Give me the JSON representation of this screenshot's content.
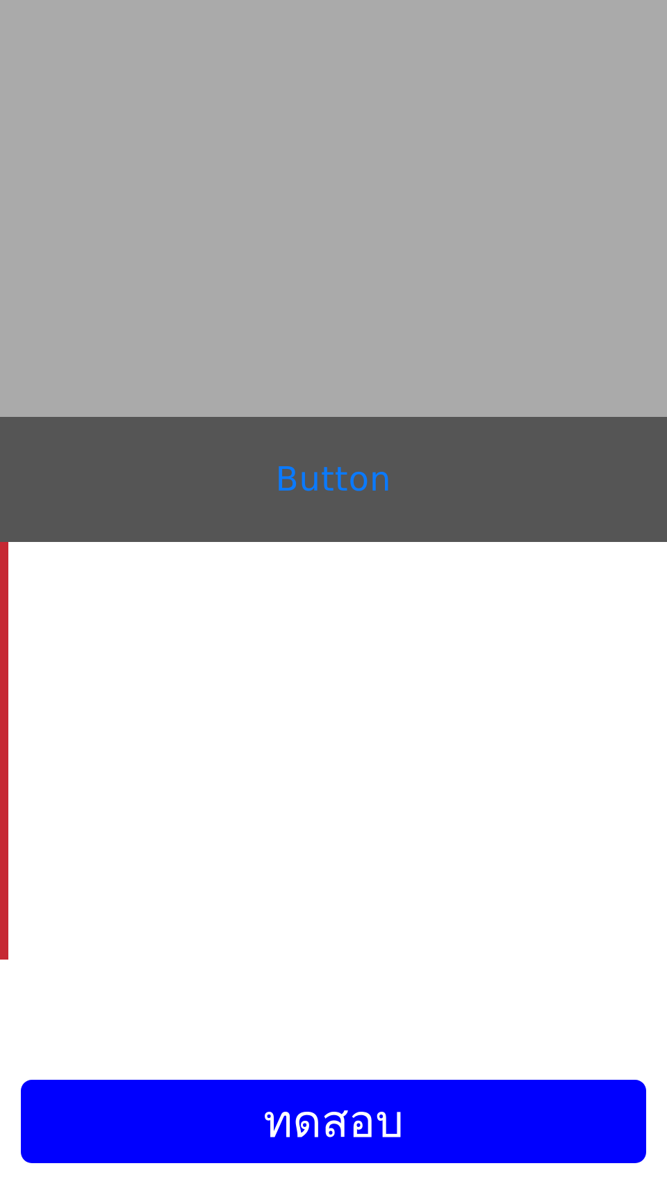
{
  "top_panel": {
    "color": "#aaaaaa"
  },
  "button_bar": {
    "color": "#555555",
    "button_label": "Button",
    "button_color": "#0a7aff"
  },
  "side_indicator": {
    "color": "#c62833"
  },
  "primary_action": {
    "label": "ทดสอบ",
    "color": "#0000ff",
    "text_color": "#ffffff"
  }
}
